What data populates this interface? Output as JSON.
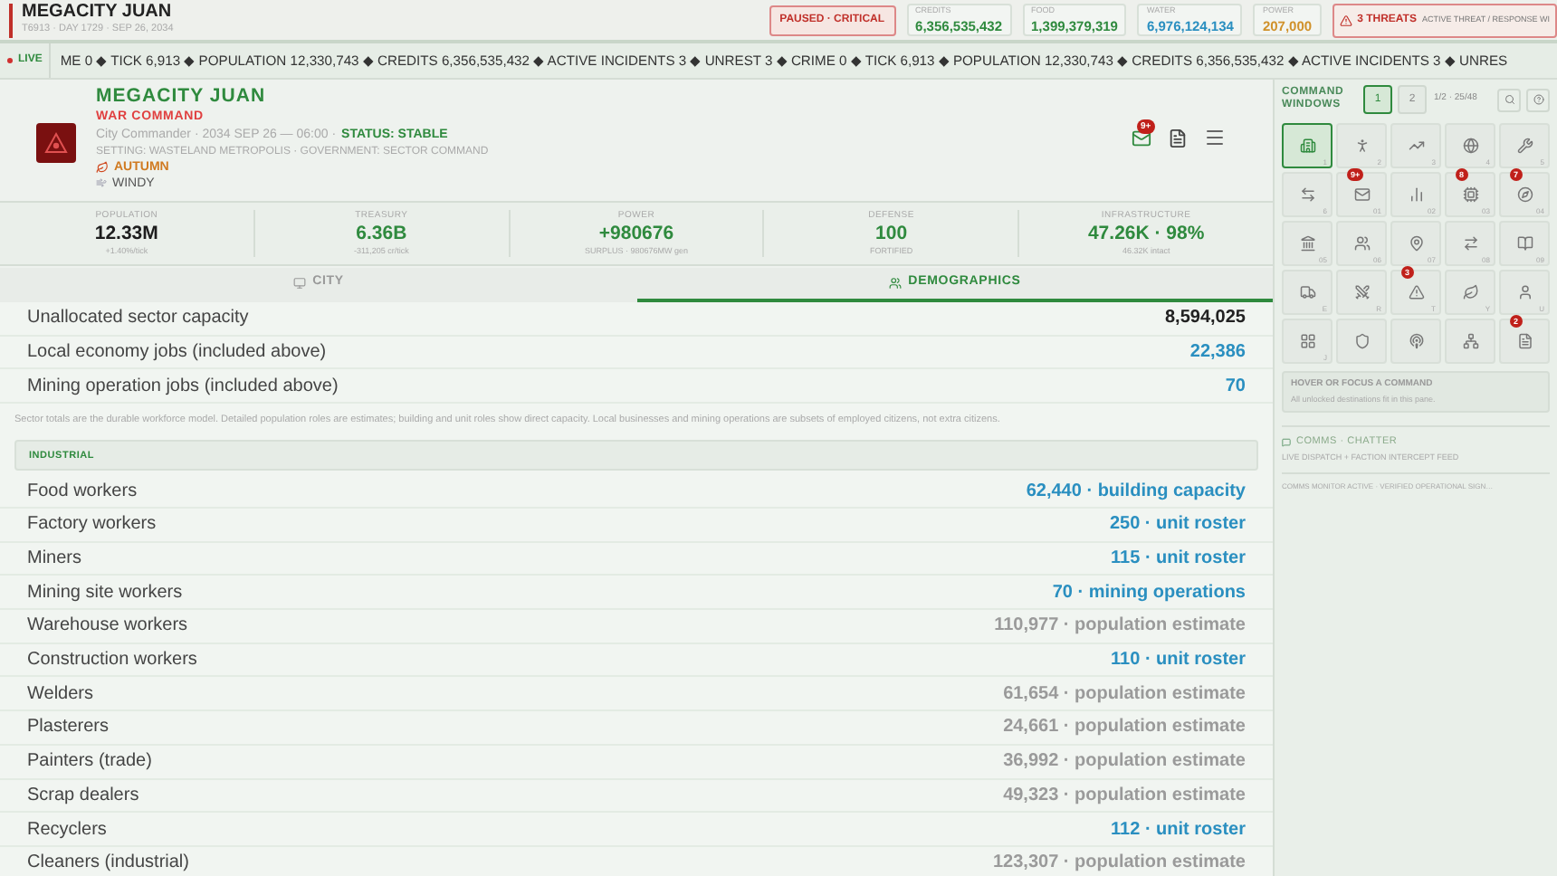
{
  "topbar": {
    "city": "MEGACITY JUAN",
    "subtitle": "T6913 · DAY 1729 · SEP 26, 2034",
    "status": "PAUSED · CRITICAL",
    "resources": [
      {
        "label": "CREDITS",
        "value": "6,356,535,432",
        "color": "#2f8a3e"
      },
      {
        "label": "FOOD",
        "value": "1,399,379,319",
        "color": "#2f8a3e"
      },
      {
        "label": "WATER",
        "value": "6,976,124,134",
        "color": "#2a8fc0"
      },
      {
        "label": "POWER",
        "value": "207,000",
        "color": "#d0912a"
      }
    ],
    "threats": {
      "label": "3 THREATS",
      "detail": "ACTIVE THREAT / RESPONSE WI"
    }
  },
  "ticker": {
    "live": "LIVE",
    "text": "ME 0 ◆ TICK 6,913 ◆ POPULATION 12,330,743 ◆ CREDITS 6,356,535,432 ◆ ACTIVE INCIDENTS 3 ◆ UNREST 3 ◆ CRIME 0 ◆ TICK 6,913 ◆ POPULATION 12,330,743 ◆ CREDITS 6,356,535,432 ◆ ACTIVE INCIDENTS 3 ◆ UNRES"
  },
  "header": {
    "title": "MEGACITY JUAN",
    "role": "WAR COMMAND",
    "line": "City Commander · 2034 SEP 26 — 06:00 ·",
    "status": "STATUS: STABLE",
    "setting": "SETTING: WASTELAND METROPOLIS · GOVERNMENT: SECTOR COMMAND",
    "season": "AUTUMN",
    "weather": "WINDY",
    "mail_badge": "9+"
  },
  "stats": [
    {
      "label": "POPULATION",
      "value": "12.33M",
      "sub": "+1.40%/tick",
      "kind": "dark"
    },
    {
      "label": "TREASURY",
      "value": "6.36B",
      "sub": "-311,205 cr/tick",
      "kind": "green"
    },
    {
      "label": "POWER",
      "value": "+980676",
      "sub": "SURPLUS · 980676MW gen",
      "kind": "green"
    },
    {
      "label": "DEFENSE",
      "value": "100",
      "sub": "FORTIFIED",
      "kind": "green"
    },
    {
      "label": "INFRASTRUCTURE",
      "value": "47.26K · 98%",
      "sub": "46.32K intact",
      "kind": "green"
    }
  ],
  "tabs": [
    {
      "label": "CITY",
      "selected": false
    },
    {
      "label": "DEMOGRAPHICS",
      "selected": true
    }
  ],
  "summary_rows": [
    {
      "label": "Unallocated sector capacity",
      "value": "8,594,025",
      "kind": "total"
    },
    {
      "label": "Local economy jobs (included above)",
      "value": "22,386",
      "kind": "capacity"
    },
    {
      "label": "Mining operation jobs (included above)",
      "value": "70",
      "kind": "capacity"
    }
  ],
  "note": "Sector totals are the durable workforce model. Detailed population roles are estimates; building and unit roles show direct capacity. Local businesses and mining operations are subsets of employed citizens, not extra citizens.",
  "section": {
    "title": "INDUSTRIAL",
    "rows": [
      {
        "label": "Food workers",
        "value": "62,440 · building capacity",
        "kind": "capacity"
      },
      {
        "label": "Factory workers",
        "value": "250 · unit roster",
        "kind": "capacity"
      },
      {
        "label": "Miners",
        "value": "115 · unit roster",
        "kind": "capacity"
      },
      {
        "label": "Mining site workers",
        "value": "70 · mining operations",
        "kind": "capacity"
      },
      {
        "label": "Warehouse workers",
        "value": "110,977 · population estimate",
        "kind": "estimate"
      },
      {
        "label": "Construction workers",
        "value": "110 · unit roster",
        "kind": "capacity"
      },
      {
        "label": "Welders",
        "value": "61,654 · population estimate",
        "kind": "estimate"
      },
      {
        "label": "Plasterers",
        "value": "24,661 · population estimate",
        "kind": "estimate"
      },
      {
        "label": "Painters (trade)",
        "value": "36,992 · population estimate",
        "kind": "estimate"
      },
      {
        "label": "Scrap dealers",
        "value": "49,323 · population estimate",
        "kind": "estimate"
      },
      {
        "label": "Recyclers",
        "value": "112 · unit roster",
        "kind": "capacity"
      },
      {
        "label": "Cleaners (industrial)",
        "value": "123,307 · population estimate",
        "kind": "estimate"
      }
    ]
  },
  "command": {
    "title": "COMMAND WINDOWS",
    "pages": [
      {
        "label": "1",
        "selected": true
      },
      {
        "label": "2",
        "selected": false
      }
    ],
    "range": "1/2 · 25/48",
    "tiles": [
      {
        "key": "1",
        "selected": true
      },
      {
        "key": "2",
        "selected": false
      },
      {
        "key": "3",
        "selected": false
      },
      {
        "key": "4",
        "selected": false
      },
      {
        "key": "5",
        "selected": false
      },
      {
        "key": "6",
        "selected": false
      },
      {
        "key": "01",
        "selected": false,
        "badge": "9+"
      },
      {
        "key": "02",
        "selected": false
      },
      {
        "key": "03",
        "selected": false,
        "badge": "8"
      },
      {
        "key": "04",
        "selected": false,
        "badge": "7"
      },
      {
        "key": "05",
        "selected": false
      },
      {
        "key": "06",
        "selected": false
      },
      {
        "key": "07",
        "selected": false
      },
      {
        "key": "08",
        "selected": false
      },
      {
        "key": "09",
        "selected": false
      },
      {
        "key": "E",
        "selected": false
      },
      {
        "key": "R",
        "selected": false
      },
      {
        "key": "T",
        "selected": false,
        "badge": "3"
      },
      {
        "key": "Y",
        "selected": false
      },
      {
        "key": "U",
        "selected": false
      },
      {
        "key": "J",
        "selected": false
      },
      {
        "selected": false
      },
      {
        "selected": false
      },
      {
        "selected": false
      },
      {
        "selected": false,
        "badge": "2"
      }
    ],
    "hint_title": "HOVER OR FOCUS A COMMAND",
    "hint_text": "All unlocked destinations fit in this pane."
  },
  "comms": {
    "title": "COMMS · CHATTER",
    "subtitle": "LIVE DISPATCH + FACTION INTERCEPT FEED",
    "status": "COMMS MONITOR ACTIVE · VERIFIED OPERATIONAL SIGN…"
  }
}
